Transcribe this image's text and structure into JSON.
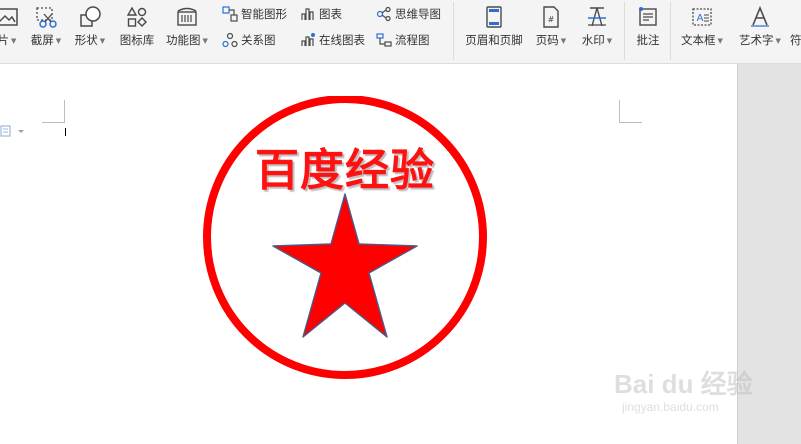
{
  "ribbon": {
    "picture_partial": "片",
    "screenshot": "截屏",
    "shapes": "形状",
    "icon_library": "图标库",
    "function_chart": "功能图",
    "smart_graphic": "智能图形",
    "chart": "图表",
    "mind_map": "思维导图",
    "relation_chart": "关系图",
    "online_chart": "在线图表",
    "flowchart": "流程图",
    "header_footer": "页眉和页脚",
    "page_number": "页码",
    "watermark": "水印",
    "comment": "批注",
    "textbox": "文本框",
    "wordart": "艺术字",
    "partial_next": "符"
  },
  "document": {
    "stamp_text": "百度经验"
  },
  "colors": {
    "stamp_red": "#ff0000",
    "ribbon_bg": "#f4f4f4",
    "page_bg": "#ffffff",
    "side_gray": "#e3e3e3"
  },
  "watermark": {
    "main": "Bai du 经验",
    "sub": "jingyan.baidu.com"
  }
}
